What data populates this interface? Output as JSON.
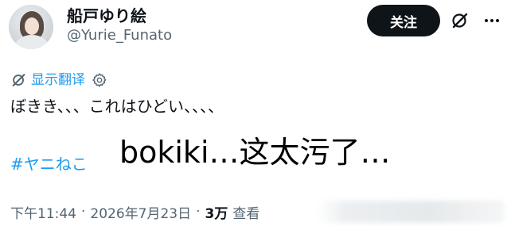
{
  "user": {
    "display_name": "船戸ゆり絵",
    "handle": "@Yurie_Funato",
    "avatar_icon": "avatar"
  },
  "actions": {
    "follow_label": "关注",
    "grok_icon": "grok-icon",
    "more_icon": "more-icon"
  },
  "translate": {
    "link_label": "显示翻译",
    "icon": "translate-icon",
    "settings_icon": "gear-icon"
  },
  "tweet": {
    "text": "ぼきき、、、これはひどい、、、、",
    "hashtag": "#ヤニねこ"
  },
  "overlay": {
    "caption": "bokiki…这太污了…"
  },
  "meta": {
    "time": "下午11:44",
    "date": "2026年7月23日",
    "views_count": "3万",
    "views_label": "查看"
  },
  "colors": {
    "text_primary": "#0f1419",
    "text_secondary": "#536471",
    "link": "#1d9bf0",
    "button_bg": "#0f1419"
  }
}
